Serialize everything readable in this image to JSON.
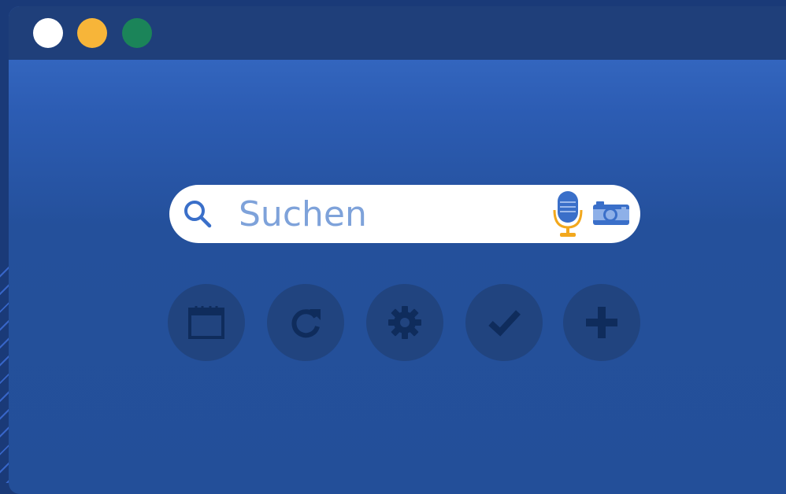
{
  "window": {
    "buttons": [
      "close",
      "minimize",
      "maximize"
    ],
    "colors": {
      "close": "#ffffff",
      "minimize": "#f7b539",
      "maximize": "#1b8459"
    }
  },
  "search": {
    "placeholder": "Suchen",
    "icons": [
      "search-icon",
      "microphone-icon",
      "camera-icon"
    ]
  },
  "quick_actions": [
    {
      "icon": "calendar-icon"
    },
    {
      "icon": "refresh-icon"
    },
    {
      "icon": "settings-gear-icon"
    },
    {
      "icon": "checkmark-icon"
    },
    {
      "icon": "plus-icon"
    }
  ],
  "colors": {
    "accent": "#3a6fc9",
    "icon_dark": "#0f2c5c",
    "button_bg": "#21447f"
  }
}
